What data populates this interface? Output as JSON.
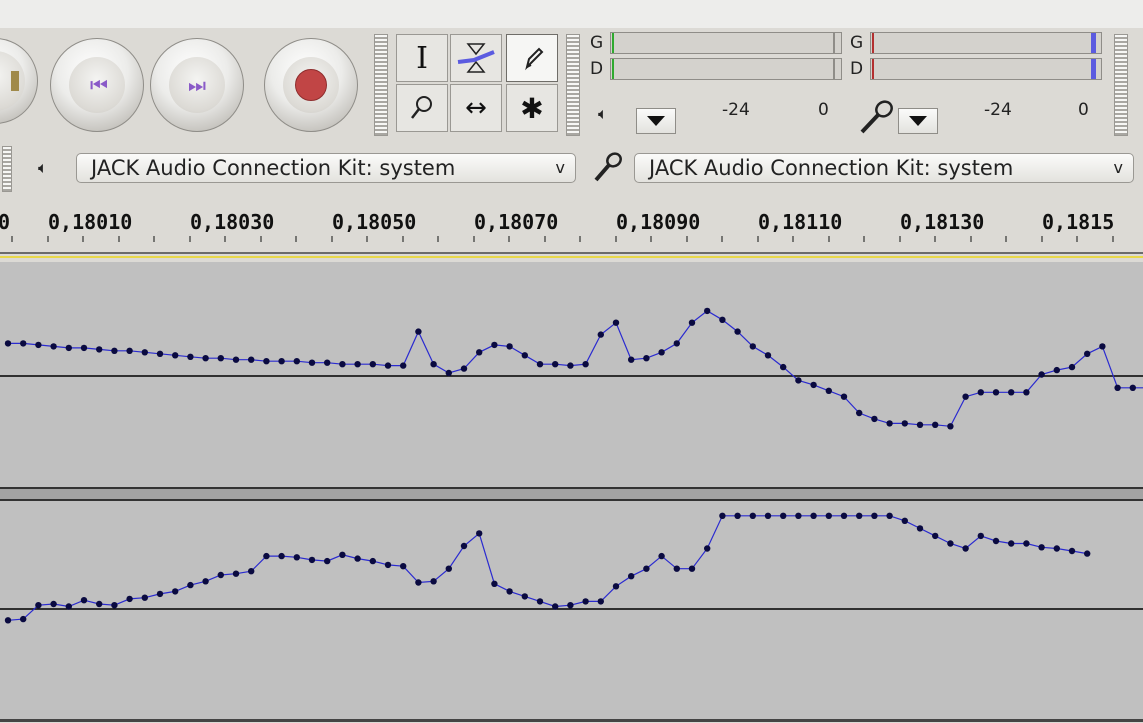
{
  "toolbar": {
    "transport": {
      "pause_icon": "pause-icon",
      "skip_start_icon": "skip-to-start-icon",
      "skip_end_icon": "skip-to-end-icon",
      "record_icon": "record-icon"
    },
    "tools": {
      "selection": "I",
      "multi": "✱",
      "timeshift": "↔"
    },
    "meters": {
      "playback": {
        "left": "G",
        "right": "D",
        "scale_mid": "-24",
        "scale_end": "0"
      },
      "record": {
        "left": "G",
        "right": "D",
        "scale_mid": "-24",
        "scale_end": "0"
      }
    }
  },
  "device": {
    "output": "JACK Audio Connection Kit: system",
    "input": "JACK Audio Connection Kit: system",
    "arrow": "v"
  },
  "ruler": {
    "labels": [
      "0",
      "0,18010",
      "0,18030",
      "0,18050",
      "0,18070",
      "0,18090",
      "0,18110",
      "0,18130",
      "0,1815"
    ]
  },
  "colors": {
    "waveform": "#2a2ad0",
    "sample_dot": "#0a0a40",
    "track_bg": "#c0c0c0",
    "record_red": "#c14545",
    "skip_purple": "#8a5ac8",
    "meter_green": "#2faa2f",
    "meter_red": "#b33030",
    "meter_peak_blue": "#5b5be0"
  },
  "tracks": [
    {
      "channel": "left",
      "samples": [
        0.22,
        0.22,
        0.21,
        0.2,
        0.19,
        0.19,
        0.18,
        0.17,
        0.17,
        0.16,
        0.15,
        0.14,
        0.13,
        0.12,
        0.12,
        0.11,
        0.11,
        0.1,
        0.1,
        0.1,
        0.09,
        0.09,
        0.08,
        0.08,
        0.08,
        0.07,
        0.07,
        0.3,
        0.08,
        0.02,
        0.05,
        0.16,
        0.21,
        0.2,
        0.14,
        0.08,
        0.08,
        0.07,
        0.08,
        0.28,
        0.36,
        0.11,
        0.12,
        0.16,
        0.22,
        0.36,
        0.44,
        0.38,
        0.3,
        0.2,
        0.14,
        0.06,
        -0.03,
        -0.06,
        -0.1,
        -0.14,
        -0.25,
        -0.29,
        -0.32,
        -0.32,
        -0.33,
        -0.33,
        -0.34,
        -0.14,
        -0.11,
        -0.11,
        -0.11,
        -0.11,
        0.01,
        0.04,
        0.06,
        0.15,
        0.2,
        -0.08,
        -0.08,
        -0.08
      ]
    },
    {
      "channel": "right",
      "samples": [
        -0.09,
        -0.08,
        0.03,
        0.04,
        0.02,
        0.07,
        0.04,
        0.03,
        0.08,
        0.09,
        0.12,
        0.14,
        0.19,
        0.22,
        0.27,
        0.28,
        0.3,
        0.42,
        0.42,
        0.41,
        0.39,
        0.38,
        0.43,
        0.4,
        0.38,
        0.35,
        0.34,
        0.21,
        0.22,
        0.32,
        0.5,
        0.6,
        0.2,
        0.14,
        0.1,
        0.06,
        0.02,
        0.03,
        0.06,
        0.06,
        0.18,
        0.26,
        0.32,
        0.42,
        0.32,
        0.32,
        0.48,
        0.74,
        0.74,
        0.74,
        0.74,
        0.74,
        0.74,
        0.74,
        0.74,
        0.74,
        0.74,
        0.74,
        0.74,
        0.7,
        0.64,
        0.58,
        0.52,
        0.48,
        0.58,
        0.54,
        0.52,
        0.52,
        0.49,
        0.48,
        0.46,
        0.44
      ]
    }
  ]
}
